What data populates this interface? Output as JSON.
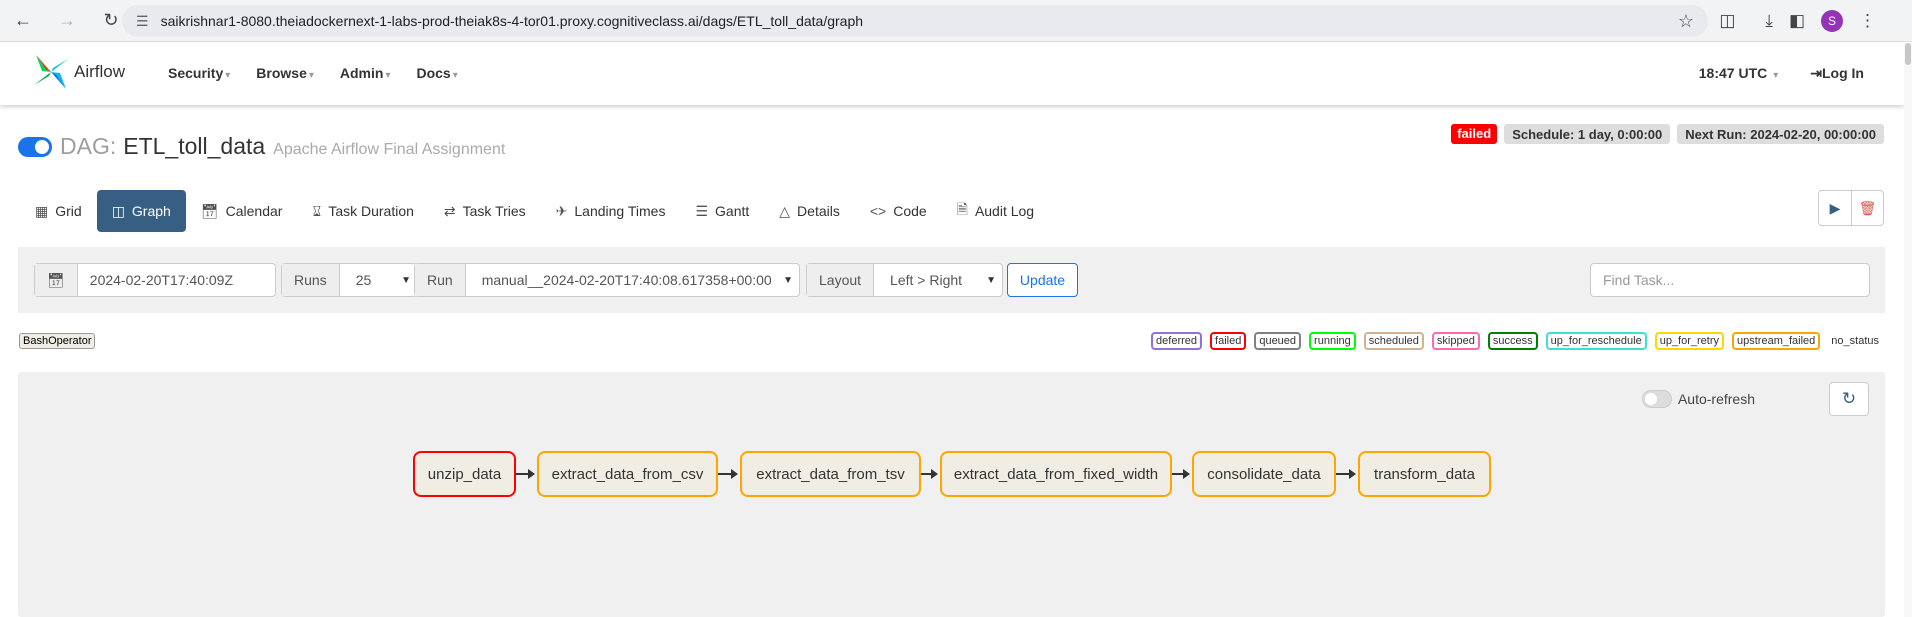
{
  "browser": {
    "url": "saikrishnar1-8080.theiadockernext-1-labs-prod-theiak8s-4-tor01.proxy.cognitiveclass.ai/dags/ETL_toll_data/graph",
    "profile_initial": "S"
  },
  "navbar": {
    "brand": "Airflow",
    "menu": [
      "Security",
      "Browse",
      "Admin",
      "Docs"
    ],
    "time": "18:47 UTC",
    "login": "Log In"
  },
  "dag": {
    "label": "DAG:",
    "id": "ETL_toll_data",
    "description": "Apache Airflow Final Assignment",
    "status": "failed",
    "schedule": "Schedule: 1 day, 0:00:00",
    "next_run": "Next Run: 2024-02-20, 00:00:00"
  },
  "tabs": [
    {
      "label": "Grid",
      "icon": "grid-icon"
    },
    {
      "label": "Graph",
      "icon": "graph-icon"
    },
    {
      "label": "Calendar",
      "icon": "calendar-icon"
    },
    {
      "label": "Task Duration",
      "icon": "hourglass-icon"
    },
    {
      "label": "Task Tries",
      "icon": "retry-icon"
    },
    {
      "label": "Landing Times",
      "icon": "plane-landing-icon"
    },
    {
      "label": "Gantt",
      "icon": "gantt-icon"
    },
    {
      "label": "Details",
      "icon": "warning-triangle-icon"
    },
    {
      "label": "Code",
      "icon": "code-icon"
    },
    {
      "label": "Audit Log",
      "icon": "audit-log-icon"
    }
  ],
  "filters": {
    "base_date": "2024-02-20T17:40:09Z",
    "runs_label": "Runs",
    "runs_value": "25",
    "run_label": "Run",
    "run_value": "manual__2024-02-20T17:40:08.617358+00:00",
    "layout_label": "Layout",
    "layout_value": "Left > Right",
    "update": "Update",
    "find_task_placeholder": "Find Task..."
  },
  "operator_legend": "BashOperator",
  "state_legend": [
    {
      "label": "deferred",
      "color": "#9370db"
    },
    {
      "label": "failed",
      "color": "#ff0000"
    },
    {
      "label": "queued",
      "color": "#808080"
    },
    {
      "label": "running",
      "color": "#00ff00"
    },
    {
      "label": "scheduled",
      "color": "#d2b48c"
    },
    {
      "label": "skipped",
      "color": "#ff69b4"
    },
    {
      "label": "success",
      "color": "#008000"
    },
    {
      "label": "up_for_reschedule",
      "color": "#40e0d0"
    },
    {
      "label": "up_for_retry",
      "color": "#ffd700"
    },
    {
      "label": "upstream_failed",
      "color": "#ffa500"
    },
    {
      "label": "no_status",
      "color": ""
    }
  ],
  "graph": {
    "auto_refresh": "Auto-refresh",
    "tasks": [
      {
        "id": "unzip_data",
        "state": "failed"
      },
      {
        "id": "extract_data_from_csv",
        "state": "upstream_failed"
      },
      {
        "id": "extract_data_from_tsv",
        "state": "upstream_failed"
      },
      {
        "id": "extract_data_from_fixed_width",
        "state": "upstream_failed"
      },
      {
        "id": "consolidate_data",
        "state": "upstream_failed"
      },
      {
        "id": "transform_data",
        "state": "upstream_failed"
      }
    ]
  }
}
